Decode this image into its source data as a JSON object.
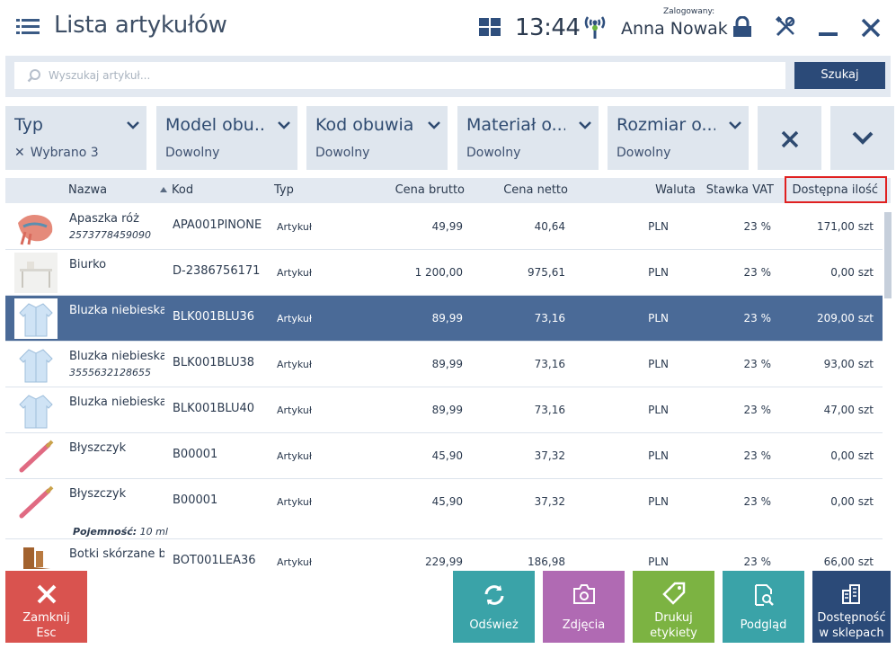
{
  "header": {
    "title": "Lista artykułów",
    "time": "13:44",
    "logged_label": "Zalogowany:",
    "user": "Anna Nowak"
  },
  "search": {
    "placeholder": "Wyszukaj artykuł...",
    "button": "Szukaj"
  },
  "filters": [
    {
      "title": "Typ",
      "value": "Wybrano 3"
    },
    {
      "title": "Model obu...",
      "value": "Dowolny"
    },
    {
      "title": "Kod obuwia",
      "value": "Dowolny"
    },
    {
      "title": "Materiał o...",
      "value": "Dowolny"
    },
    {
      "title": "Rozmiar o...",
      "value": "Dowolny"
    }
  ],
  "table": {
    "columns": {
      "nazwa": "Nazwa",
      "kod": "Kod",
      "typ": "Typ",
      "brutto": "Cena brutto",
      "netto": "Cena netto",
      "waluta": "Waluta",
      "vat": "Stawka VAT",
      "qty": "Dostępna ilość"
    },
    "rows": [
      {
        "name": "Apaszka róż",
        "ean": "2573778459090",
        "code": "APA001PINONE",
        "typ": "Artykuł",
        "brutto": "49,99",
        "netto": "40,64",
        "waluta": "PLN",
        "vat": "23 %",
        "qty": "171,00 szt"
      },
      {
        "name": "Biurko",
        "ean": "",
        "code": "D-2386756171",
        "typ": "Artykuł",
        "brutto": "1 200,00",
        "netto": "975,61",
        "waluta": "PLN",
        "vat": "23 %",
        "qty": "0,00 szt"
      },
      {
        "name": "Bluzka niebieska",
        "ean": "",
        "code": "BLK001BLU36",
        "typ": "Artykuł",
        "brutto": "89,99",
        "netto": "73,16",
        "waluta": "PLN",
        "vat": "23 %",
        "qty": "209,00 szt"
      },
      {
        "name": "Bluzka niebieska",
        "ean": "3555632128655",
        "code": "BLK001BLU38",
        "typ": "Artykuł",
        "brutto": "89,99",
        "netto": "73,16",
        "waluta": "PLN",
        "vat": "23 %",
        "qty": "93,00 szt"
      },
      {
        "name": "Bluzka niebieska",
        "ean": "",
        "code": "BLK001BLU40",
        "typ": "Artykuł",
        "brutto": "89,99",
        "netto": "73,16",
        "waluta": "PLN",
        "vat": "23 %",
        "qty": "47,00 szt"
      },
      {
        "name": "Błyszczyk",
        "ean": "",
        "code": "B00001",
        "typ": "Artykuł",
        "brutto": "45,90",
        "netto": "37,32",
        "waluta": "PLN",
        "vat": "23 %",
        "qty": "0,00 szt"
      },
      {
        "name": "Błyszczyk",
        "ean": "",
        "code": "B00001",
        "typ": "Artykuł",
        "brutto": "45,90",
        "netto": "37,32",
        "waluta": "PLN",
        "vat": "23 %",
        "qty": "0,00 szt"
      },
      {
        "name": "Botki skórzane br",
        "ean": "",
        "code": "BOT001LEA36",
        "typ": "Artykuł",
        "brutto": "229,99",
        "netto": "186,98",
        "waluta": "PLN",
        "vat": "23 %",
        "qty": "66,00 szt"
      }
    ],
    "attribute_label": "Pojemność:",
    "attribute_value": "10 ml"
  },
  "buttons": {
    "close_line1": "Zamknij",
    "close_line2": "Esc",
    "refresh": "Odśwież",
    "photos": "Zdjęcia",
    "print_line1": "Drukuj",
    "print_line2": "etykiety",
    "preview": "Podgląd",
    "avail_line1": "Dostępność",
    "avail_line2": "w sklepach"
  },
  "colors": {
    "accent": "#2b4a78",
    "selected_row": "#4a6a97",
    "close_button": "#d9534f",
    "teal_button": "#3aa3a8",
    "purple_button": "#b06ab3",
    "green_button": "#7cb342",
    "highlight": "#e02020"
  }
}
